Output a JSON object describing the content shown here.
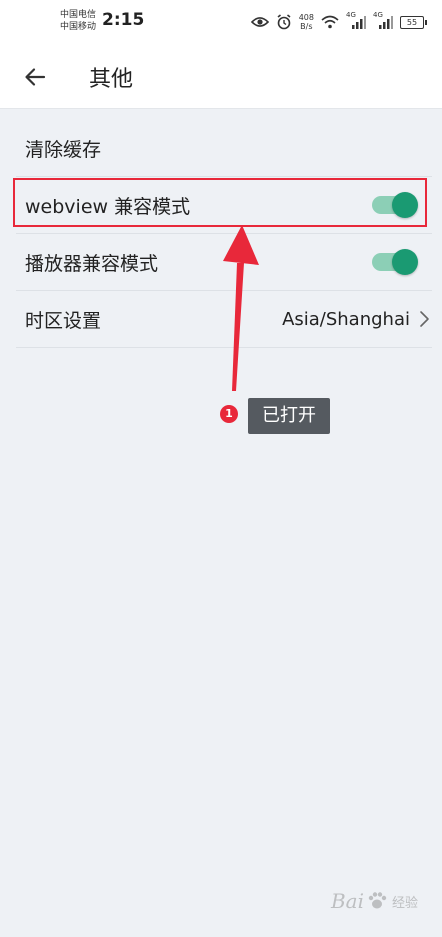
{
  "status_bar": {
    "carrier_1": "中国电信",
    "carrier_2": "中国移动",
    "time": "2:15",
    "net_speed_value": "408",
    "net_speed_unit": "B/s",
    "signal_1_label": "4G",
    "signal_2_label": "4G",
    "battery": "55",
    "icons": [
      "eye-icon",
      "alarm-icon",
      "wifi-icon",
      "signal-icon",
      "signal-icon",
      "battery-icon"
    ]
  },
  "header": {
    "title": "其他",
    "back_icon": "arrow-left-icon"
  },
  "settings": {
    "items": [
      {
        "label": "清除缓存",
        "type": "action"
      },
      {
        "label": "webview 兼容模式",
        "type": "toggle",
        "on": true
      },
      {
        "label": "播放器兼容模式",
        "type": "toggle",
        "on": true
      },
      {
        "label": "时区设置",
        "type": "select",
        "value": "Asia/Shanghai"
      }
    ]
  },
  "annotation": {
    "step_number": "1",
    "callout_text": "已打开",
    "color": "#e8283a"
  },
  "watermark": {
    "brand": "Bai",
    "suffix": "经验"
  },
  "colors": {
    "toggle_knob": "#1a9a72",
    "toggle_track": "#8ccfb6",
    "background": "#eef1f5",
    "highlight": "#e8283a"
  }
}
